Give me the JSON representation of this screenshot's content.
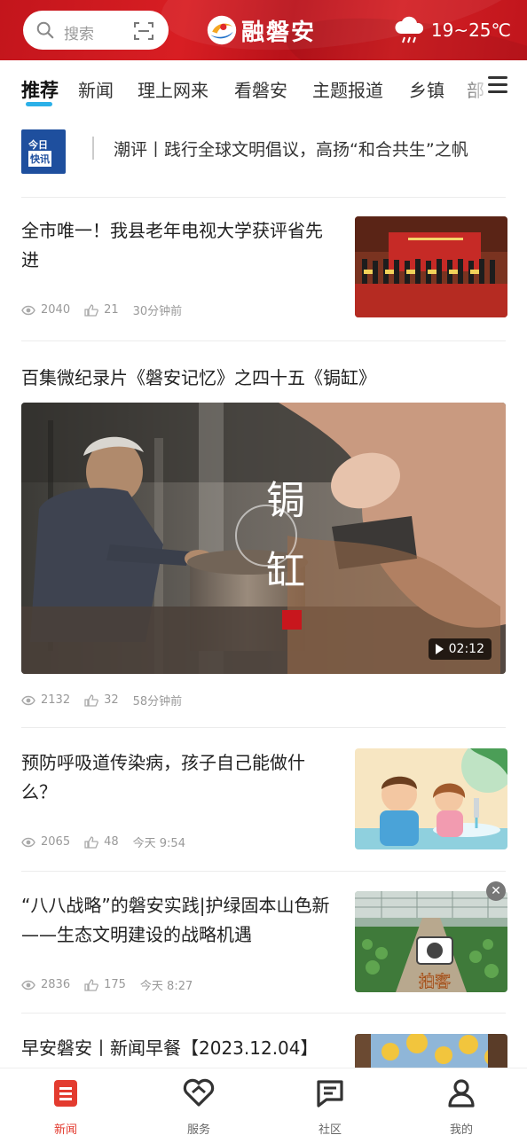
{
  "header": {
    "search_placeholder": "搜索",
    "brand_name": "融磐安",
    "weather": "19~25℃"
  },
  "tabs": [
    {
      "label": "推荐",
      "active": true
    },
    {
      "label": "新闻"
    },
    {
      "label": "理上网来"
    },
    {
      "label": "看磐安"
    },
    {
      "label": "主题报道"
    },
    {
      "label": "乡镇"
    },
    {
      "label": "部"
    }
  ],
  "flash": {
    "badge_line1": "今日",
    "badge_line2": "快讯",
    "text": "潮评丨践行全球文明倡议，高扬“和合共生”之帆"
  },
  "articles": [
    {
      "title": "全市唯一！我县老年电视大学获评省先进",
      "views": "2040",
      "likes": "21",
      "time": "30分钟前"
    },
    {
      "title": "百集微纪录片《磐安记忆》之四十五《锔缸》",
      "overlay_char1": "锔",
      "overlay_char2": "缸",
      "duration": "02:12",
      "views": "2132",
      "likes": "32",
      "time": "58分钟前"
    },
    {
      "title": "预防呼吸道传染病，孩子自己能做什么？",
      "views": "2065",
      "likes": "48",
      "time": "今天 9:54"
    },
    {
      "title": "“八八战略”的磐安实践|护绿固本山色新 ——生态文明建设的战略机遇",
      "views": "2836",
      "likes": "175",
      "time": "今天 8:27",
      "thumb_text": "拍客"
    },
    {
      "title": "早安磐安丨新闻早餐【2023.12.04】"
    }
  ],
  "bottom_nav": [
    {
      "label": "新闻",
      "active": true
    },
    {
      "label": "服务"
    },
    {
      "label": "社区"
    },
    {
      "label": "我的"
    }
  ],
  "colors": {
    "header_red": "#c8161d",
    "tab_underline": "#2bb0e8",
    "nav_active": "#e33b2f"
  }
}
